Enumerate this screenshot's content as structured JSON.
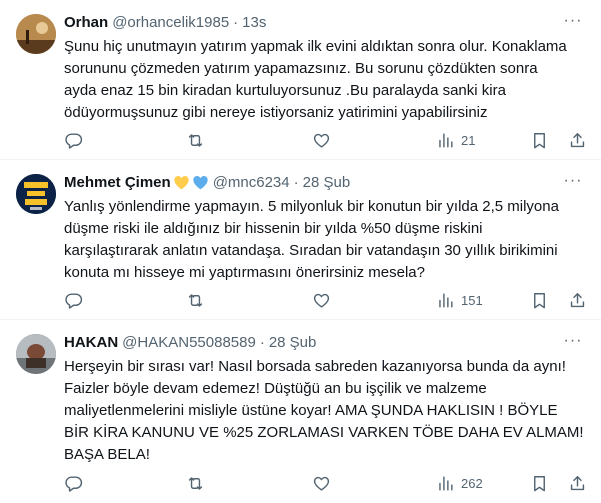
{
  "tweets": [
    {
      "name": "Orhan",
      "handle": "@orhancelik1985",
      "time": "13s",
      "text": "Şunu hiç unutmayın yatırım yapmak ilk evini aldıktan sonra olur. Konaklama\nsorununu çözmeden yatırım yapamazsınız. Bu sorunu çözdükten sonra\nayda enaz 15 bin kiradan kurtuluyorsunuz .Bu paralayda sanki kira\nödüyormuşsunuz gibi nereye istiyorsaniz yatirimini yapabilirsiniz",
      "views": "21"
    },
    {
      "name": "Mehmet Çimen",
      "handle": "@mnc6234",
      "time": "28 Şub",
      "text": "Yanlış yönlendirme yapmayın. 5 milyonluk bir konutun bir yılda 2,5 milyona\ndüşme riski ile aldığınız bir hissenin bir yılda %50 düşme riskini\nkarşılaştırarak anlatın vatandaşa. Sıradan bir vatandaşın 30 yıllık birikimini\nkonuta mı hisseye mi yaptırmasını önerirsiniz mesela?",
      "views": "151"
    },
    {
      "name": "HAKAN",
      "handle": "@HAKAN55088589",
      "time": "28 Şub",
      "text": "Herşeyin bir sırası var! Nasıl borsada sabreden kazanıyorsa bunda da aynı!\nFaizler böyle devam edemez! Düştüğü an bu işçilik ve malzeme\nmaliyetlenmelerini misliyle üstüne koyar! AMA ŞUNDA HAKLISIN ! BÖYLE\nBİR KİRA KANUNU VE  %25 ZORLAMASI VARKEN TÖBE DAHA EV ALMAM!\nBAŞA BELA!",
      "views": "262"
    }
  ],
  "dot_separator": "·",
  "more_label": "···",
  "icons": [
    "reply-icon",
    "retweet-icon",
    "like-icon",
    "views-icon",
    "bookmark-icon",
    "share-icon"
  ],
  "colors": {
    "text": "#0f1419",
    "secondary": "#536471",
    "divider": "#eff3f4",
    "heart_yellow": "#ffcc4d",
    "heart_blue": "#5dadec"
  }
}
